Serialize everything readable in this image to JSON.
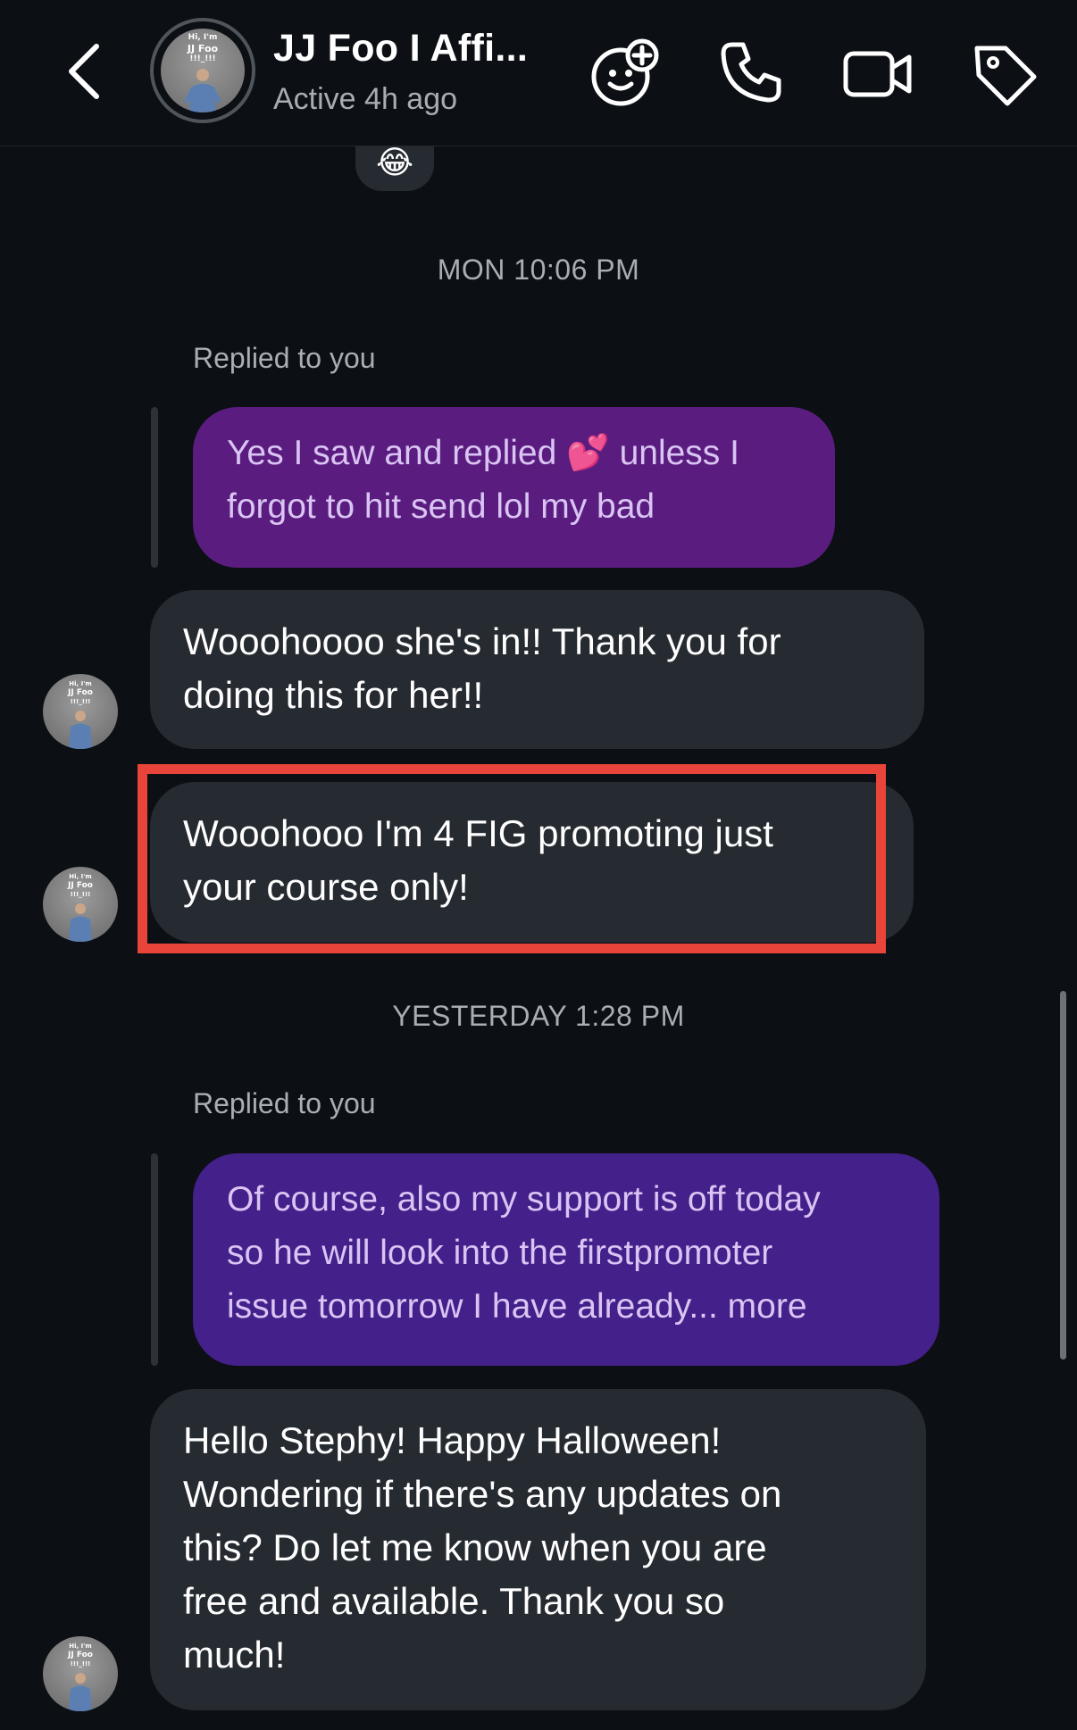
{
  "header": {
    "title": "JJ Foo I Affi...",
    "status": "Active 4h ago",
    "avatar_text": {
      "line1": "Hi, I'm",
      "line2": "JJ Foo",
      "line3": "!!!_!!!"
    }
  },
  "icons": {
    "back": "chevron-left-icon",
    "effects": "sticker-face-icon",
    "call": "phone-icon",
    "video": "video-camera-icon",
    "tag": "tag-icon"
  },
  "top_reaction": "😂",
  "timestamps": {
    "first": "MON 10:06 PM",
    "second": "YESTERDAY 1:28 PM"
  },
  "replied_label": "Replied to you",
  "quote1": {
    "line1_before": "Yes I saw and replied",
    "emoji": "💕",
    "line1_after": "unless I",
    "line2": "forgot to hit send lol my bad"
  },
  "msg1": {
    "line1": "Wooohoooo she's in!! Thank you for",
    "line2": "doing this for her!!"
  },
  "msg2": {
    "line1": "Wooohooo I'm 4 FIG promoting just",
    "line2": "your course only!"
  },
  "quote2": {
    "line1": "Of course, also my support is off today",
    "line2": "so he will look into the firstpromoter",
    "line3": "issue tomorrow I have already... more"
  },
  "msg3": {
    "line1": "Hello Stephy! Happy Halloween!",
    "line2": "Wondering if there's any updates on",
    "line3": "this? Do let me know when you are",
    "line4": "free and available. Thank you so",
    "line5": "much!"
  },
  "colors": {
    "background": "#0c0f14",
    "incoming_bubble": "#262a31",
    "quote1_bubble": "#5a1d7f",
    "quote2_bubble": "#43208a",
    "highlight": "#e8443a"
  }
}
